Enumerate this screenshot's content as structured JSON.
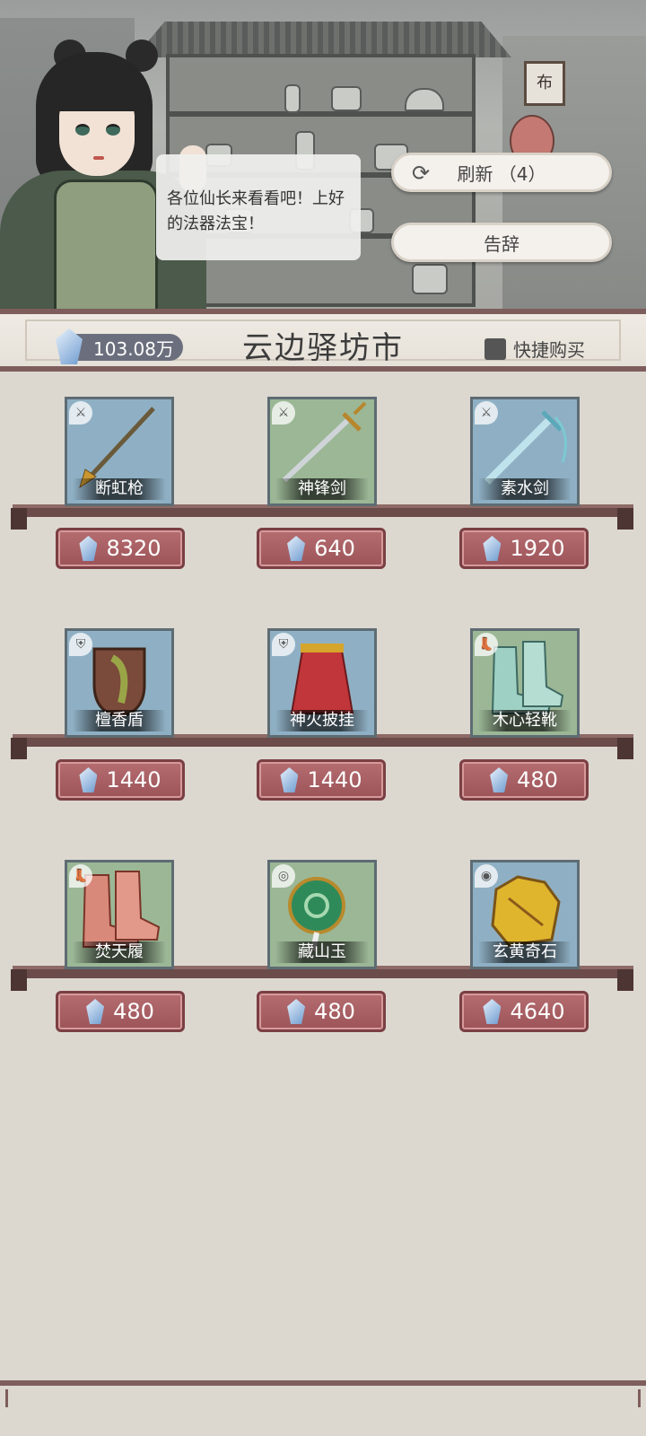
{
  "dialog": {
    "text": "各位仙长来看看吧！上好的法器法宝！"
  },
  "buttons": {
    "refresh_label": "刷新 （4）",
    "leave_label": "告辞"
  },
  "header": {
    "currency": "103.08万",
    "title": "云边驿坊市",
    "quick_buy_label": "快捷购买"
  },
  "shop_sign": "布",
  "items": [
    {
      "name": "断虹枪",
      "price": "8320",
      "bg": "blue",
      "slot_icon": "weapon-icon"
    },
    {
      "name": "神锋剑",
      "price": "640",
      "bg": "green",
      "slot_icon": "weapon-icon"
    },
    {
      "name": "素水剑",
      "price": "1920",
      "bg": "blue",
      "slot_icon": "weapon-icon"
    },
    {
      "name": "檀香盾",
      "price": "1440",
      "bg": "blue",
      "slot_icon": "armor-icon"
    },
    {
      "name": "神火披挂",
      "price": "1440",
      "bg": "blue",
      "slot_icon": "armor-icon"
    },
    {
      "name": "木心轻靴",
      "price": "480",
      "bg": "green",
      "slot_icon": "boots-icon"
    },
    {
      "name": "焚天履",
      "price": "480",
      "bg": "green",
      "slot_icon": "boots-icon"
    },
    {
      "name": "藏山玉",
      "price": "480",
      "bg": "green",
      "slot_icon": "jade-icon"
    },
    {
      "name": "玄黄奇石",
      "price": "4640",
      "bg": "blue",
      "slot_icon": "stone-icon"
    }
  ]
}
